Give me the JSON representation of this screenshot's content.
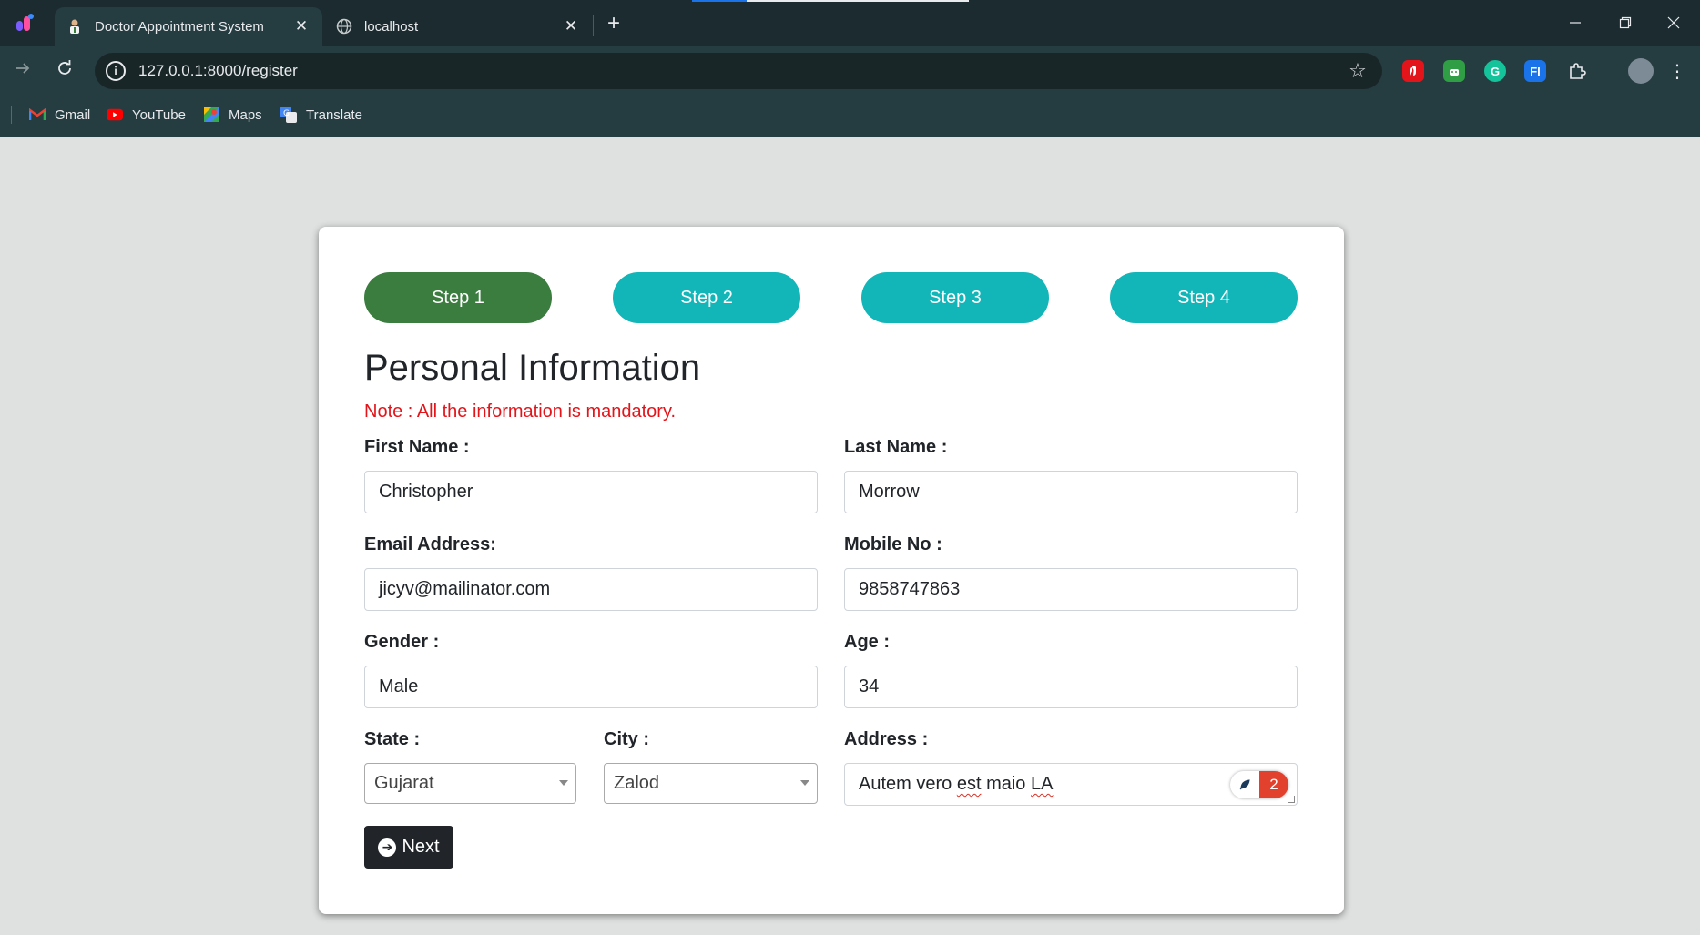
{
  "browser": {
    "tabs": [
      {
        "title": "Doctor Appointment System",
        "active": true,
        "icon": "doctor-icon"
      },
      {
        "title": "localhost",
        "active": false,
        "icon": "globe-icon"
      }
    ],
    "close_glyph": "✕",
    "new_tab_glyph": "+",
    "url": "127.0.0.1:8000/register",
    "bookmarks": [
      {
        "label": "Gmail",
        "icon": "gmail-icon"
      },
      {
        "label": "YouTube",
        "icon": "youtube-icon"
      },
      {
        "label": "Maps",
        "icon": "maps-icon"
      },
      {
        "label": "Translate",
        "icon": "translate-icon"
      }
    ],
    "extensions": [
      {
        "name": "adblock-extension-icon",
        "color": "#e3151a"
      },
      {
        "name": "android-extension-icon",
        "color": "#2f9e44"
      },
      {
        "name": "grammarly-extension-icon",
        "color": "#15c39a",
        "glyph": "G"
      },
      {
        "name": "translate-extension-icon",
        "color": "#1a73e8",
        "glyph": "FI"
      }
    ]
  },
  "steps": [
    {
      "label": "Step 1",
      "active": true
    },
    {
      "label": "Step 2",
      "active": false
    },
    {
      "label": "Step 3",
      "active": false
    },
    {
      "label": "Step 4",
      "active": false
    }
  ],
  "colors": {
    "step_active": "#3a7d3f",
    "step_inactive": "#12b5b8",
    "note": "#e3151a",
    "button": "#212529"
  },
  "form": {
    "heading": "Personal Information",
    "note": "Note : All the information is mandatory.",
    "first_name": {
      "label": "First Name :",
      "value": "Christopher"
    },
    "last_name": {
      "label": "Last Name :",
      "value": "Morrow"
    },
    "email": {
      "label": "Email Address:",
      "value": "jicyv@mailinator.com"
    },
    "mobile": {
      "label": "Mobile No :",
      "value": "9858747863"
    },
    "gender": {
      "label": "Gender :",
      "value": "Male"
    },
    "age": {
      "label": "Age :",
      "value": "34"
    },
    "state": {
      "label": "State :",
      "value": "Gujarat"
    },
    "city": {
      "label": "City :",
      "value": "Zalod"
    },
    "address": {
      "label": "Address :",
      "value_parts": [
        "Autem vero ",
        "est",
        " maio ",
        "LA"
      ],
      "grammar_issue_count": "2"
    },
    "next_label": "Next"
  }
}
